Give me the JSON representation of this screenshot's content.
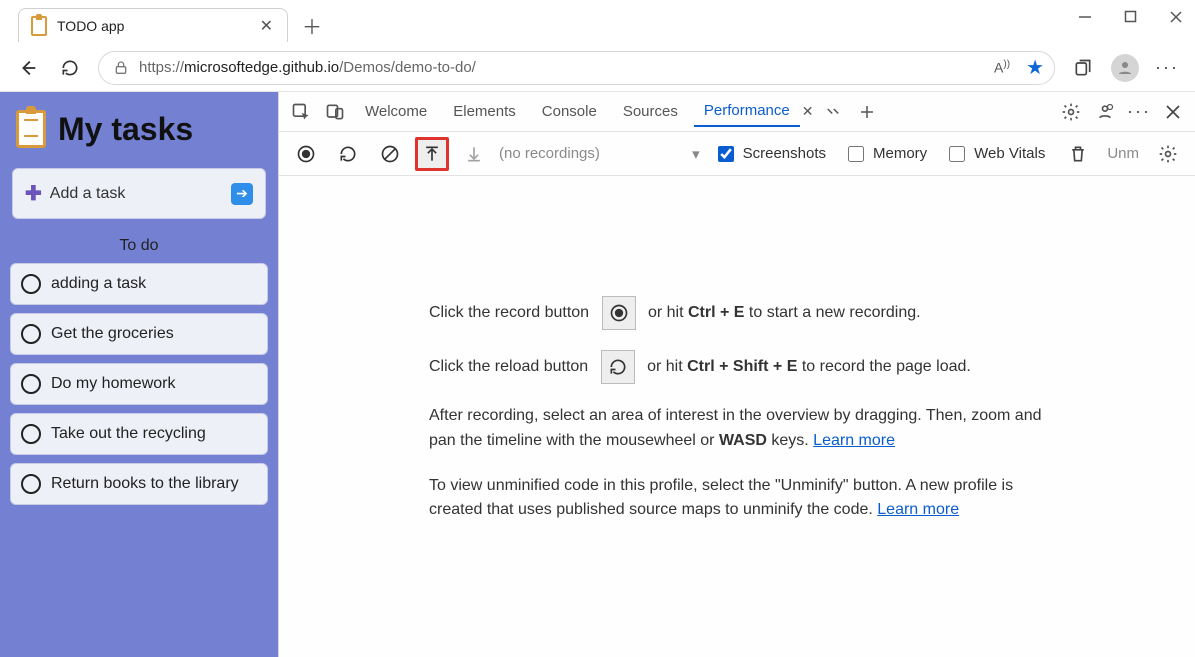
{
  "browser": {
    "tab_title": "TODO app",
    "url_secure_part": "https://",
    "url_host_part": "microsoftedge.github.io",
    "url_path_part": "/Demos/demo-to-do/"
  },
  "app": {
    "title": "My tasks",
    "add_label": "Add a task",
    "section": "To do",
    "tasks": [
      "adding a task",
      "Get the groceries",
      "Do my homework",
      "Take out the recycling",
      "Return books to the library"
    ]
  },
  "devtools": {
    "tabs": {
      "welcome": "Welcome",
      "elements": "Elements",
      "console": "Console",
      "sources": "Sources",
      "performance": "Performance"
    },
    "toolbar": {
      "placeholder": "(no recordings)",
      "screenshots": "Screenshots",
      "memory": "Memory",
      "webvitals": "Web Vitals",
      "unm": "Unm"
    },
    "body": {
      "p1a": "Click the record button",
      "p1b": " or hit ",
      "p1c": "Ctrl + E",
      "p1d": " to start a new recording.",
      "p2a": "Click the reload button",
      "p2b": " or hit ",
      "p2c": "Ctrl + Shift + E",
      "p2d": " to record the page load.",
      "p3a": "After recording, select an area of interest in the overview by dragging. Then, zoom and pan the timeline with the mousewheel or ",
      "p3b": "WASD",
      "p3c": " keys. ",
      "p3link": "Learn more",
      "p4a": "To view unminified code in this profile, select the \"Unminify\" button. A new profile is created that uses published source maps to unminify the code. ",
      "p4link": "Learn more"
    }
  }
}
